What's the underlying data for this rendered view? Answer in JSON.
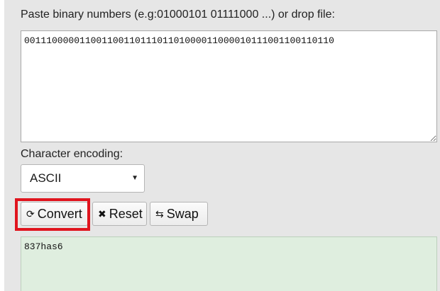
{
  "input": {
    "label": "Paste binary numbers (e.g:01000101 01111000 ...) or drop file:",
    "value": "00111000001100110011011101101000011000010111001100110110"
  },
  "encoding": {
    "label": "Character encoding:",
    "selected": "ASCII"
  },
  "buttons": {
    "convert_label": "Convert",
    "convert_icon": "refresh-icon",
    "reset_label": "Reset",
    "reset_icon": "x-icon",
    "swap_label": "Swap",
    "swap_icon": "swap-arrows-icon"
  },
  "highlight": {
    "target": "convert-button",
    "color": "#e0141e"
  },
  "output": {
    "value": "837has6",
    "background": "#dfeedf"
  }
}
